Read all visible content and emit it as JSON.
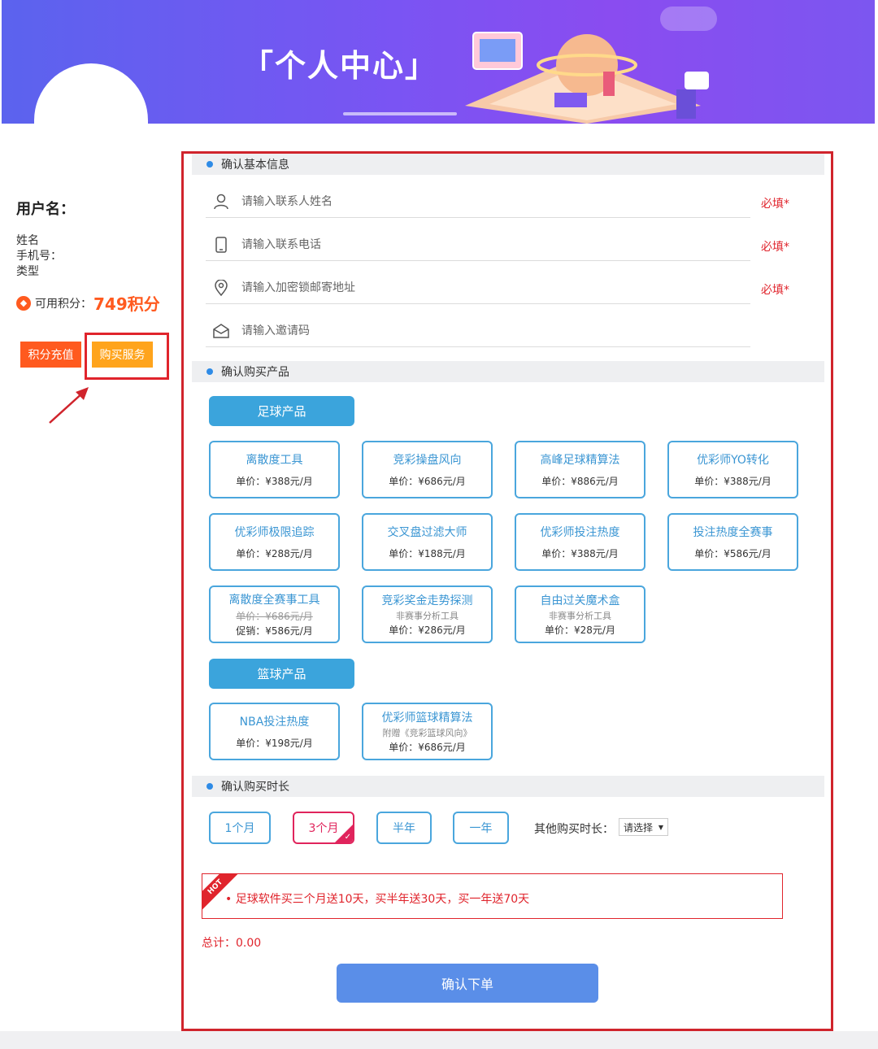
{
  "banner": {
    "title": "「个人中心」"
  },
  "sidebar": {
    "username_label": "用户名：",
    "name_label": "姓名",
    "phone_label": "手机号：",
    "type_label": "类型",
    "points_label": "可用积分：",
    "points_value": "749积分",
    "recharge_button": "积分充值",
    "buy_service_button": "购买服务"
  },
  "sections": {
    "basic_info": "确认基本信息",
    "products": "确认购买产品",
    "duration": "确认购买时长"
  },
  "form": {
    "contact_name_placeholder": "请输入联系人姓名",
    "contact_phone_placeholder": "请输入联系电话",
    "address_placeholder": "请输入加密锁邮寄地址",
    "invite_placeholder": "请输入邀请码",
    "required_text": "必填*"
  },
  "categories": {
    "football": "足球产品",
    "basketball": "篮球产品"
  },
  "football_products": [
    {
      "name": "离散度工具",
      "price": "单价：¥388元/月"
    },
    {
      "name": "竞彩操盘风向",
      "price": "单价：¥686元/月"
    },
    {
      "name": "高峰足球精算法",
      "price": "单价：¥886元/月"
    },
    {
      "name": "优彩师YO转化",
      "price": "单价：¥388元/月"
    },
    {
      "name": "优彩师极限追踪",
      "price": "单价：¥288元/月"
    },
    {
      "name": "交叉盘过滤大师",
      "price": "单价：¥188元/月"
    },
    {
      "name": "优彩师投注热度",
      "price": "单价：¥388元/月"
    },
    {
      "name": "投注热度全赛事",
      "price": "单价：¥586元/月"
    },
    {
      "name": "离散度全赛事工具",
      "old_price": "单价：¥686元/月",
      "price": "促销：¥586元/月"
    },
    {
      "name": "竞彩奖金走势探测",
      "sub": "非赛事分析工具",
      "price": "单价：¥286元/月"
    },
    {
      "name": "自由过关魔术盒",
      "sub": "非赛事分析工具",
      "price": "单价：¥28元/月"
    }
  ],
  "basketball_products": [
    {
      "name": "NBA投注热度",
      "price": "单价：¥198元/月"
    },
    {
      "name": "优彩师篮球精算法",
      "sub": "附赠《竞彩篮球风向》",
      "price": "单价：¥686元/月"
    }
  ],
  "duration": {
    "options": [
      "1个月",
      "3个月",
      "半年",
      "一年"
    ],
    "selected": "3个月",
    "other_label": "其他购买时长：",
    "select_value": "请选择"
  },
  "promo": {
    "hot_badge": "HOT",
    "text": "• 足球软件买三个月送10天，买半年送30天，买一年送70天"
  },
  "total": "总计：0.00",
  "submit_button": "确认下单",
  "colors": {
    "accent_blue": "#3ba4dc",
    "alert_red": "#e0242c",
    "orange": "#ff5a1f",
    "submit_blue": "#5a8ee8"
  }
}
